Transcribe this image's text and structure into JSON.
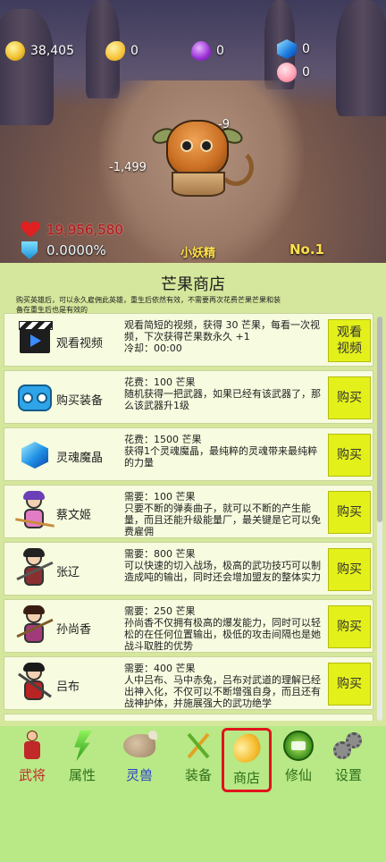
{
  "resources": {
    "gold": "38,405",
    "mango": "0",
    "purple_fruit": "0",
    "crystal": "0",
    "peach": "0"
  },
  "battle": {
    "damage_top": "-9",
    "damage_left": "-1,499",
    "enemy_hp": "19,956,580",
    "shield_percent": "0.0000%",
    "enemy_name": "小妖精",
    "rank": "No.1"
  },
  "shop": {
    "title": "芒果商店",
    "description": "购买英雄后，可以永久雇佣此英雄，重生后依然有效，不需要再次花费芒果芒果和装备在重生后也是有效的",
    "items": [
      {
        "name": "观看视频",
        "description": "观看简短的视频，获得 30 芒果，每看一次视频，下次获得芒果数永久 +1\n冷却：00:00",
        "button": "观看\n视频",
        "icon": "clapperboard-icon"
      },
      {
        "name": "购买装备",
        "description": "花费：100 芒果\n随机获得一把武器，如果已经有该武器了，那么该武器升1级",
        "button": "购买",
        "icon": "equipment-icon"
      },
      {
        "name": "灵魂魔晶",
        "description": "花费：1500 芒果\n获得1个灵魂魔晶，最纯粹的灵魂带来最纯粹的力量",
        "button": "购买",
        "icon": "soul-crystal-icon"
      },
      {
        "name": "蔡文姬",
        "description": "需要：100 芒果\n只要不断的弹奏曲子，就可以不断的产生能量，而且还能升级能量厂，最关键是它可以免费雇佣",
        "button": "购买",
        "icon": "hero-caiwenji-icon"
      },
      {
        "name": "张辽",
        "description": "需要：800 芒果\n可以快速的切入战场，极高的武功技巧可以制造成吨的输出，同时还会增加盟友的整体实力",
        "button": "购买",
        "icon": "hero-zhangliao-icon"
      },
      {
        "name": "孙尚香",
        "description": "需要：250 芒果\n孙尚香不仅拥有极高的爆发能力，同时可以轻松的在任何位置输出，极低的攻击间隔也是她战斗取胜的优势",
        "button": "购买",
        "icon": "hero-sunshangxiang-icon"
      },
      {
        "name": "吕布",
        "description": "需要：400 芒果\n人中吕布、马中赤兔，吕布对武道的理解已经出神入化，不仅可以不断增强自身，而且还有战神护体，并施展强大的武功绝学",
        "button": "购买",
        "icon": "hero-lvbu-icon"
      }
    ]
  },
  "nav": [
    {
      "label": "武将",
      "color": "#c0282a"
    },
    {
      "label": "属性",
      "color": "#2f6e1a"
    },
    {
      "label": "灵兽",
      "color": "#2a3fc9"
    },
    {
      "label": "装备",
      "color": "#2f6e1a"
    },
    {
      "label": "商店",
      "color": "#2f6e1a",
      "active": true
    },
    {
      "label": "修仙",
      "color": "#2f6e1a"
    },
    {
      "label": "设置",
      "color": "#2f6e1a"
    }
  ],
  "colors": {
    "panel_bg": "#d5e79c",
    "nav_bg": "#b8e986",
    "buy_button": "#e3f01a",
    "active_highlight": "#e0141e"
  }
}
